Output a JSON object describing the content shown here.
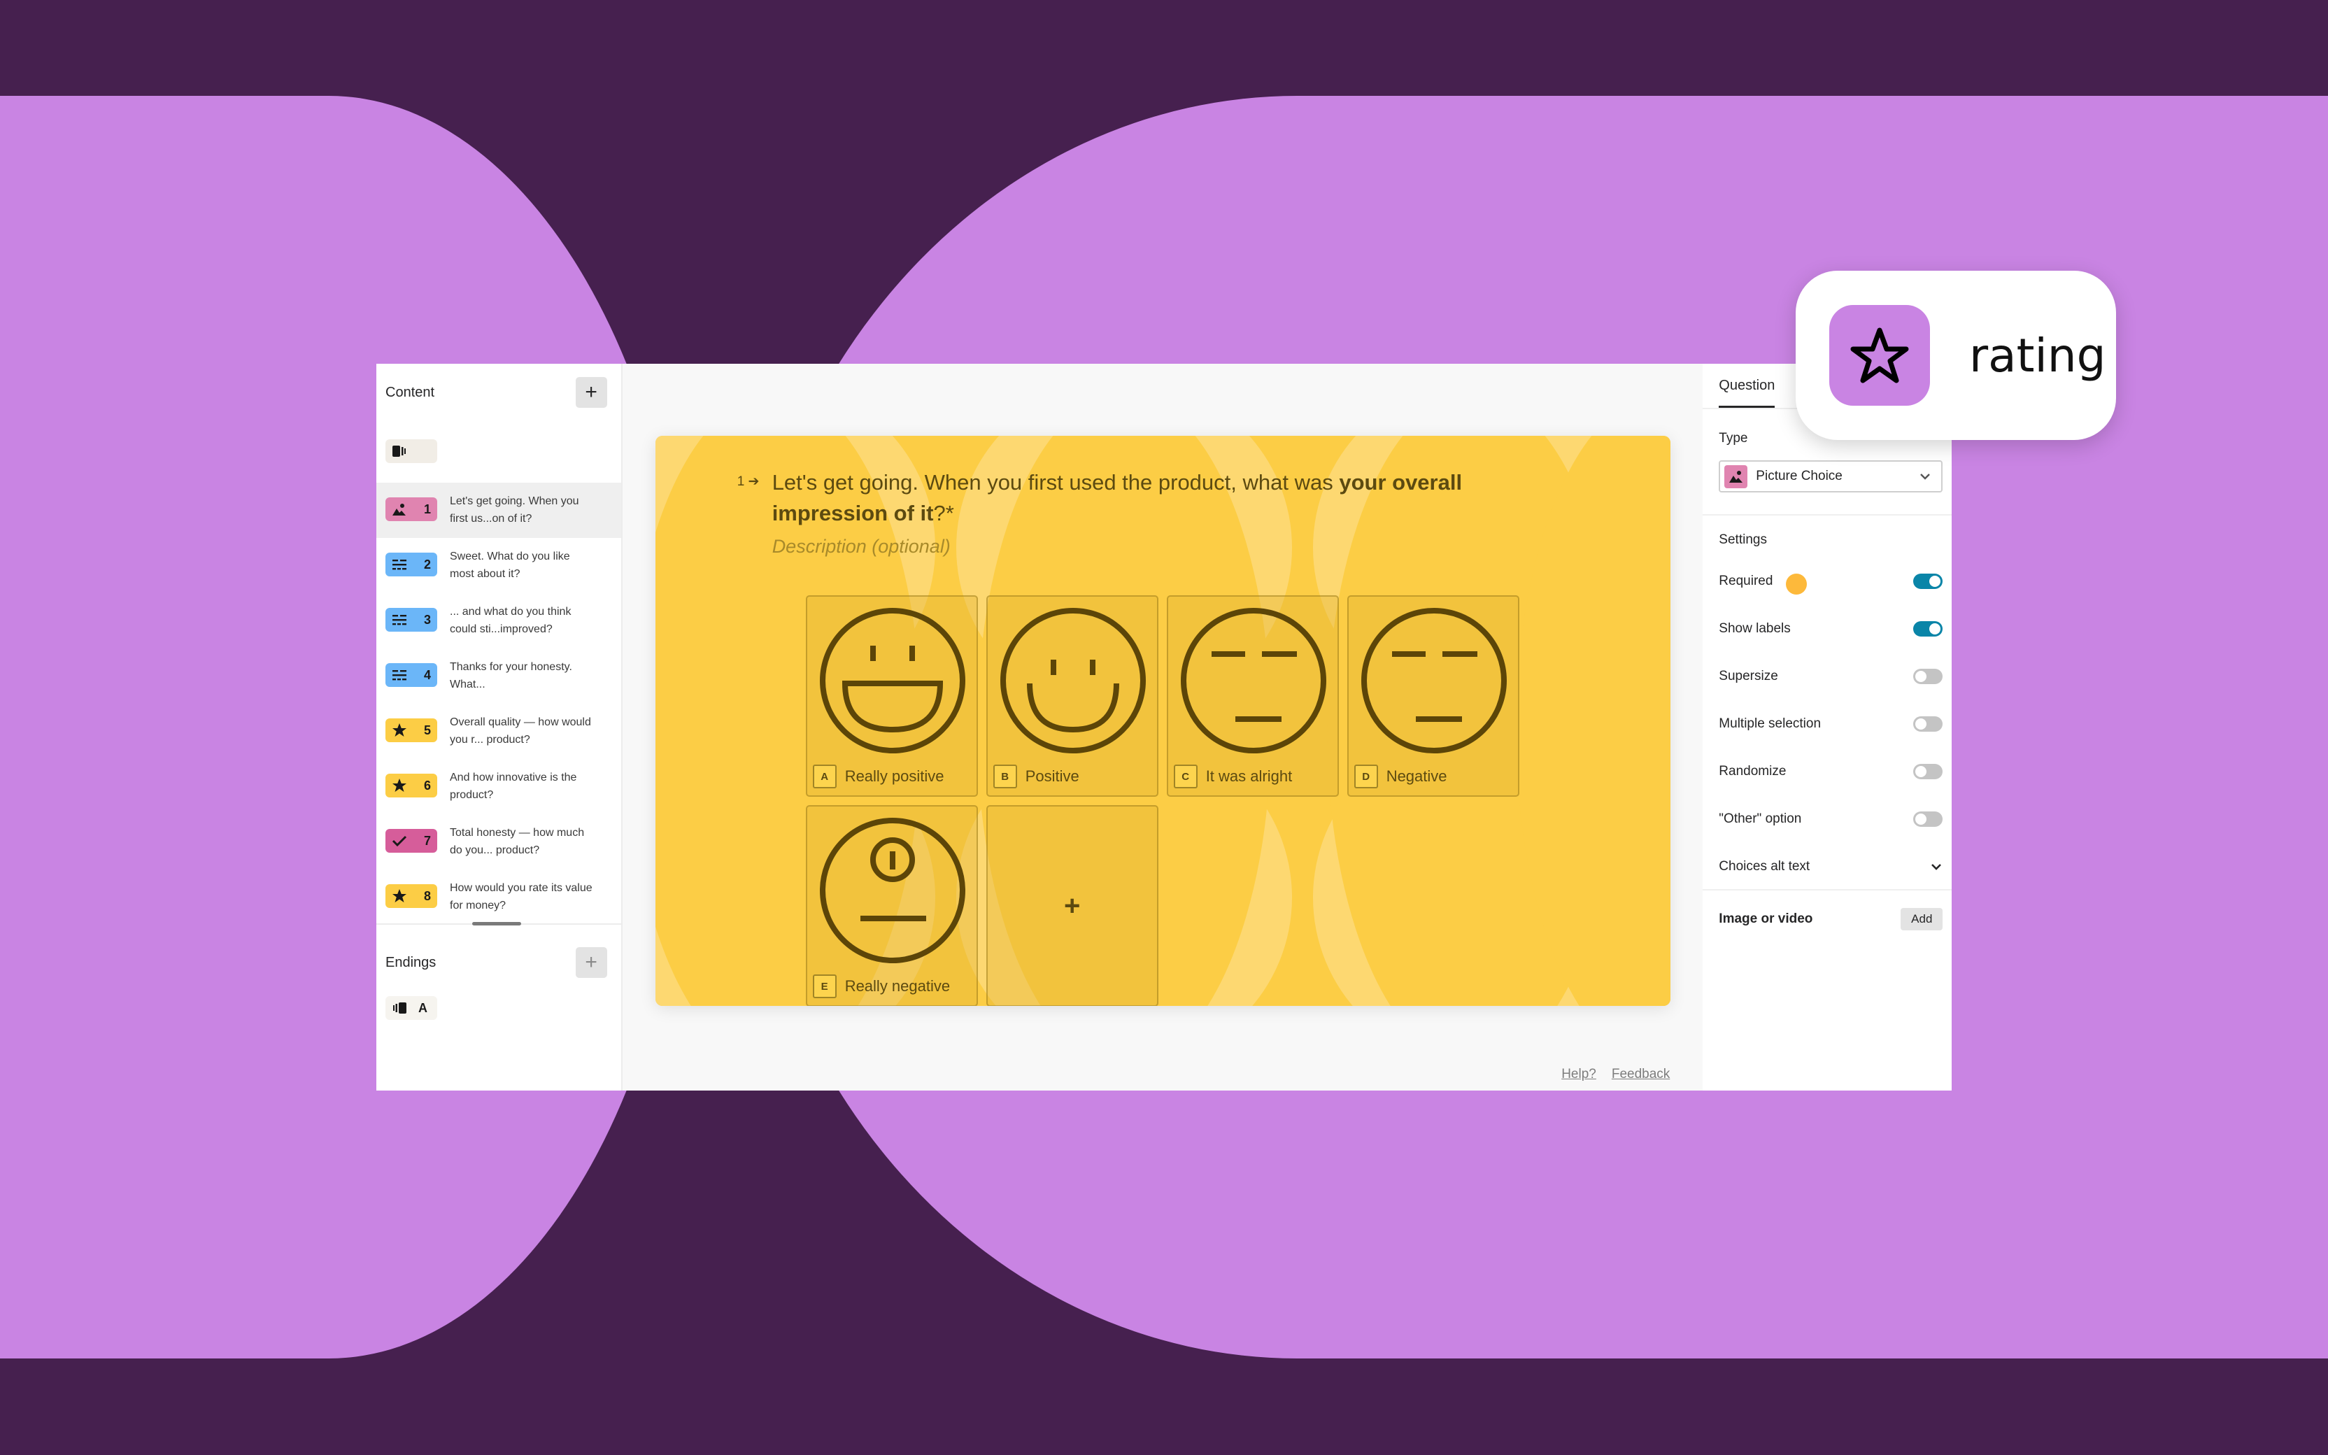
{
  "colors": {
    "background_dark": "#46204f",
    "background_purple": "#c984e3",
    "preview_yellow": "#fccd45",
    "toggle_on": "#0a85a8",
    "badge_picture": "#e084b0",
    "badge_text": "#6bb6f8",
    "badge_rating": "#fccd45",
    "badge_yesno": "#d65d9a"
  },
  "sidebar": {
    "content_title": "Content",
    "add_label": "+",
    "welcome_icon": "welcome-screen-icon",
    "items": [
      {
        "num": "1",
        "icon": "picture-icon",
        "type": "picture",
        "text": "Let's get going. When you first us...on of it?",
        "active": true
      },
      {
        "num": "2",
        "icon": "long-text-icon",
        "type": "text",
        "text": "Sweet. What do you like most about it?"
      },
      {
        "num": "3",
        "icon": "long-text-icon",
        "type": "text",
        "text": "... and what do you think could sti...improved?"
      },
      {
        "num": "4",
        "icon": "long-text-icon",
        "type": "text",
        "text": "Thanks for your honesty. What..."
      },
      {
        "num": "5",
        "icon": "star-icon",
        "type": "rating",
        "text": "Overall quality — how would you r... product?"
      },
      {
        "num": "6",
        "icon": "star-icon",
        "type": "rating",
        "text": "And how innovative is the product?"
      },
      {
        "num": "7",
        "icon": "check-icon",
        "type": "yesno",
        "text": "Total honesty — how much do you... product?"
      },
      {
        "num": "8",
        "icon": "star-icon",
        "type": "rating",
        "text": "How would you rate its value for money?"
      }
    ],
    "endings_title": "Endings",
    "ending_label": "A"
  },
  "question": {
    "number": "1",
    "title_plain": "Let's get going. When you first used the product, what was ",
    "title_bold": "your overall impression of it",
    "title_suffix": "?*",
    "description_placeholder": "Description (optional)",
    "choices": [
      {
        "key": "A",
        "label": "Really positive",
        "face": "really-positive"
      },
      {
        "key": "B",
        "label": "Positive",
        "face": "positive"
      },
      {
        "key": "C",
        "label": "It was alright",
        "face": "neutral"
      },
      {
        "key": "D",
        "label": "Negative",
        "face": "negative"
      },
      {
        "key": "E",
        "label": "Really negative",
        "face": "really-negative"
      }
    ],
    "add_choice_label": "+"
  },
  "footer": {
    "help": "Help?",
    "feedback": "Feedback"
  },
  "right_panel": {
    "tab": "Question",
    "type_label": "Type",
    "type_value": "Picture Choice",
    "settings_label": "Settings",
    "settings": [
      {
        "label": "Required",
        "on": true
      },
      {
        "label": "Show labels",
        "on": true
      },
      {
        "label": "Supersize",
        "on": false
      },
      {
        "label": "Multiple selection",
        "on": false
      },
      {
        "label": "Randomize",
        "on": false
      },
      {
        "label": "\"Other\" option",
        "on": false
      }
    ],
    "choices_alt_text": "Choices alt text",
    "image_or_video": "Image or video",
    "add_button": "Add"
  },
  "badge": {
    "icon": "star-outline-icon",
    "label": "rating"
  }
}
